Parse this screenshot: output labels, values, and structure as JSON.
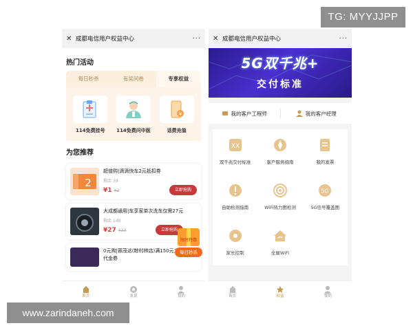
{
  "watermarks": {
    "telegram": "TG: MYYJJPP",
    "site": "www.zarindaneh.com"
  },
  "left_phone": {
    "title": "成都电信用户权益中心",
    "close_icon": "close-icon",
    "more_label": "···",
    "hot_title": "热门活动",
    "tabs": [
      {
        "label": "每日秒杀",
        "active": false
      },
      {
        "label": "有奖问卷",
        "active": false
      },
      {
        "label": "专享权益",
        "active": true
      }
    ],
    "promos": [
      {
        "label": "114免费挂号",
        "icon": "hospital-register-icon"
      },
      {
        "label": "114免费问中医",
        "icon": "doctor-icon"
      },
      {
        "label": "话费充值",
        "icon": "phone-recharge-icon"
      }
    ],
    "recommend_title": "为您推荐",
    "products": [
      {
        "name": "超值购|滴滴快车2元抵扣券",
        "stock": "剩余 39",
        "price": "¥1",
        "orig": "¥2",
        "buy": "立即抢购",
        "thumb_color": "#f0873a"
      },
      {
        "name": "大成都通用|车享家单次洗车仅需27元",
        "stock": "剩余 148",
        "price": "¥27",
        "orig": "¥33",
        "buy": "立即抢购",
        "thumb_color": "#2e3640"
      },
      {
        "name": "0元购|蓉茂达(粽村林店)满150元立减50元代金券",
        "stock": "",
        "price": "",
        "orig": "",
        "buy": "",
        "thumb_color": "#3a2a5a"
      }
    ],
    "float_badge": {
      "top_text": "限时特惠",
      "label": "每日秒杀"
    },
    "nav": [
      {
        "label": "首页",
        "active": true,
        "icon": "home-icon"
      },
      {
        "label": "发现",
        "active": false,
        "icon": "discover-icon"
      },
      {
        "label": "我的",
        "active": false,
        "icon": "user-icon"
      }
    ]
  },
  "right_phone": {
    "title": "成都电信用户权益中心",
    "more_label": "···",
    "banner": {
      "line1": "5G双千兆+",
      "line2": "交付标准"
    },
    "managers": [
      {
        "label": "我的客户工程师",
        "icon": "engineer-icon"
      },
      {
        "label": "我的客户经理",
        "icon": "manager-icon"
      }
    ],
    "services": [
      {
        "label": "双千兆交付标准",
        "icon": "double-gigabit-icon"
      },
      {
        "label": "客户服务指南",
        "icon": "compass-icon"
      },
      {
        "label": "我的发票",
        "icon": "invoice-icon"
      },
      {
        "label": "自助检测指南",
        "icon": "self-check-icon"
      },
      {
        "label": "WiFi热力图检测",
        "icon": "wifi-heatmap-icon"
      },
      {
        "label": "5G信号覆盖图",
        "icon": "5g-coverage-icon"
      },
      {
        "label": "家长控制",
        "icon": "parental-control-icon"
      },
      {
        "label": "全屋WiFi",
        "icon": "home-wifi-icon"
      }
    ],
    "nav": [
      {
        "label": "首页",
        "active": false,
        "icon": "home-icon"
      },
      {
        "label": "权益",
        "active": true,
        "icon": "benefits-icon"
      },
      {
        "label": "我的",
        "active": false,
        "icon": "user-icon"
      }
    ]
  },
  "colors": {
    "accent_gold": "#c59a55",
    "price_red": "#e03b3b",
    "buy_button": "#c73a3a",
    "banner_blue": "#3a24b8"
  }
}
